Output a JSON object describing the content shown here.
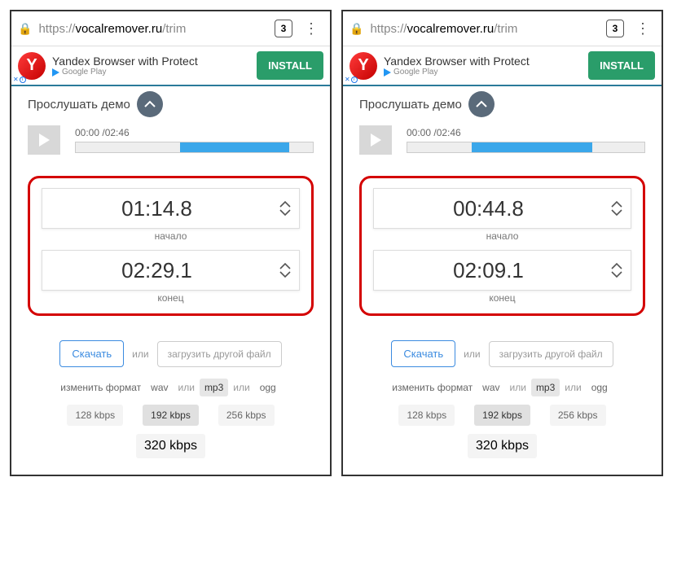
{
  "screens": [
    {
      "url": {
        "protocol": "https://",
        "host": "vocalremover.ru",
        "path": "/trim"
      },
      "tabcount": "3",
      "ad": {
        "title": "Yandex Browser with Protect",
        "store": "Google Play",
        "cta": "INSTALL"
      },
      "demo_label": "Прослушать демо",
      "time_display": "00:00 /02:46",
      "bar_start": 44,
      "bar_end": 90,
      "start_value": "01:14.8",
      "start_label": "начало",
      "end_value": "02:29.1",
      "end_label": "конец",
      "download": "Скачать",
      "or": "или",
      "upload": "загрузить другой файл",
      "format_label": "изменить формат",
      "formats": [
        "wav",
        "mp3",
        "ogg"
      ],
      "format_selected": "mp3",
      "bitrates": [
        "128 kbps",
        "192 kbps",
        "256 kbps",
        "320 kbps"
      ],
      "bitrate_selected": "192 kbps"
    },
    {
      "url": {
        "protocol": "https://",
        "host": "vocalremover.ru",
        "path": "/trim"
      },
      "tabcount": "3",
      "ad": {
        "title": "Yandex Browser with Protect",
        "store": "Google Play",
        "cta": "INSTALL"
      },
      "demo_label": "Прослушать демо",
      "time_display": "00:00 /02:46",
      "bar_start": 27,
      "bar_end": 78,
      "start_value": "00:44.8",
      "start_label": "начало",
      "end_value": "02:09.1",
      "end_label": "конец",
      "download": "Скачать",
      "or": "или",
      "upload": "загрузить другой файл",
      "format_label": "изменить формат",
      "formats": [
        "wav",
        "mp3",
        "ogg"
      ],
      "format_selected": "mp3",
      "bitrates": [
        "128 kbps",
        "192 kbps",
        "256 kbps",
        "320 kbps"
      ],
      "bitrate_selected": "192 kbps"
    }
  ]
}
